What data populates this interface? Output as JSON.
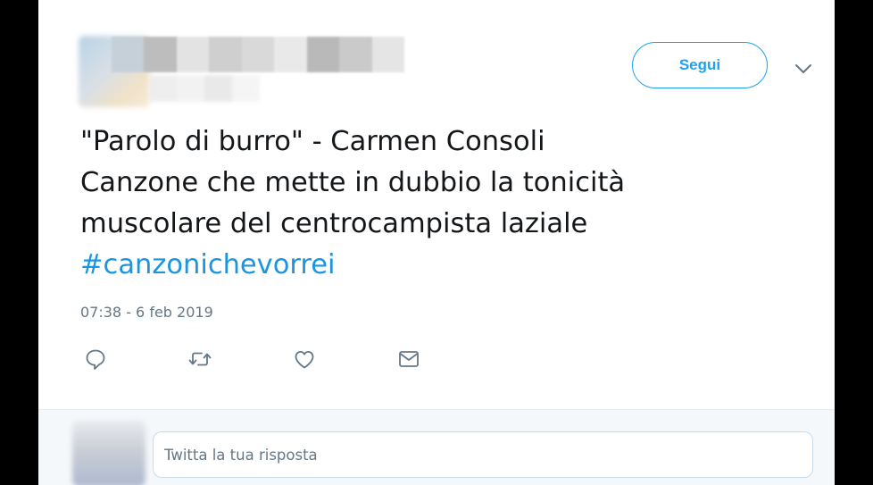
{
  "header": {
    "follow_label": "Segui",
    "caret_icon": "chevron-down-icon"
  },
  "tweet": {
    "lines": [
      "\"Parolo di burro\" - Carmen Consoli",
      "Canzone che mette in dubbio la tonicità",
      "muscolare del centrocampista laziale"
    ],
    "hashtag": "#canzonichevorrei",
    "timestamp": "07:38 - 6 feb 2019"
  },
  "actions": {
    "reply_icon": "reply-icon",
    "retweet_icon": "retweet-icon",
    "like_icon": "heart-icon",
    "dm_icon": "envelope-icon"
  },
  "reply": {
    "placeholder": "Twitta la tua risposta"
  },
  "colors": {
    "accent": "#1da1f2",
    "hashtag": "#1b95e0",
    "text": "#14171a",
    "muted": "#657786",
    "reply_bg": "#f5f8fa"
  }
}
